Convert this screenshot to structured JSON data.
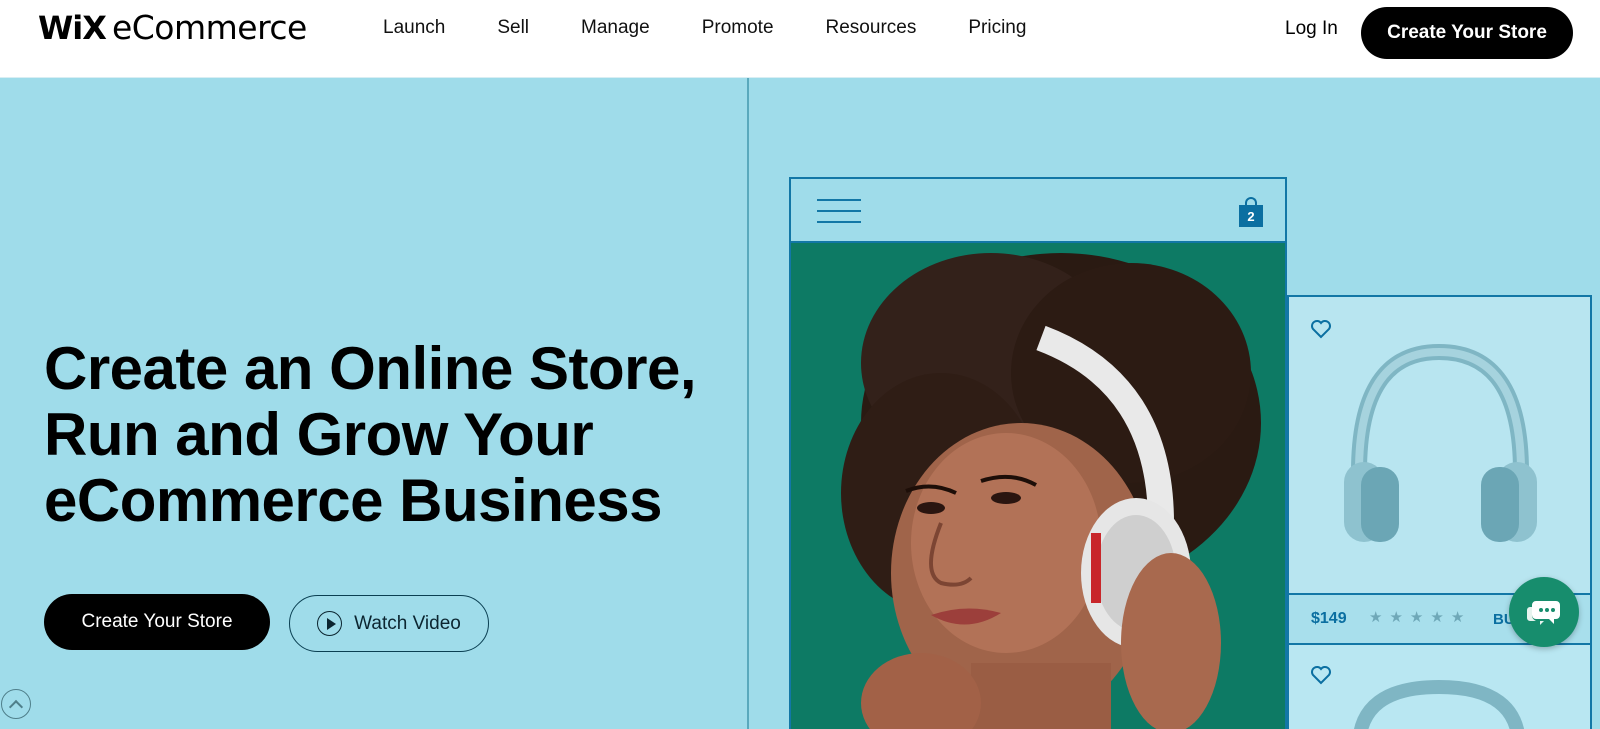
{
  "header": {
    "logo_brand": "WiX",
    "logo_product": "eCommerce",
    "nav": [
      {
        "label": "Launch"
      },
      {
        "label": "Sell"
      },
      {
        "label": "Manage"
      },
      {
        "label": "Promote"
      },
      {
        "label": "Resources"
      },
      {
        "label": "Pricing"
      }
    ],
    "login_label": "Log In",
    "cta_label": "Create Your Store"
  },
  "hero": {
    "title_lines": [
      "Create an Online Store,",
      "Run and Grow Your",
      "eCommerce Business"
    ],
    "primary_cta": "Create Your Store",
    "secondary_cta": "Watch Video"
  },
  "mockup": {
    "cart_count": "2",
    "product": {
      "price": "$149",
      "rating_stars": 5,
      "buy_label": "BU"
    }
  },
  "colors": {
    "background": "#9fdcea",
    "accent_blue": "#1277a6",
    "chat_green": "#178d6d",
    "button_black": "#000000"
  },
  "icons": [
    "menu-icon",
    "shopping-bag-icon",
    "heart-icon",
    "star-icon",
    "play-icon",
    "chevron-up-icon",
    "chat-icon"
  ]
}
